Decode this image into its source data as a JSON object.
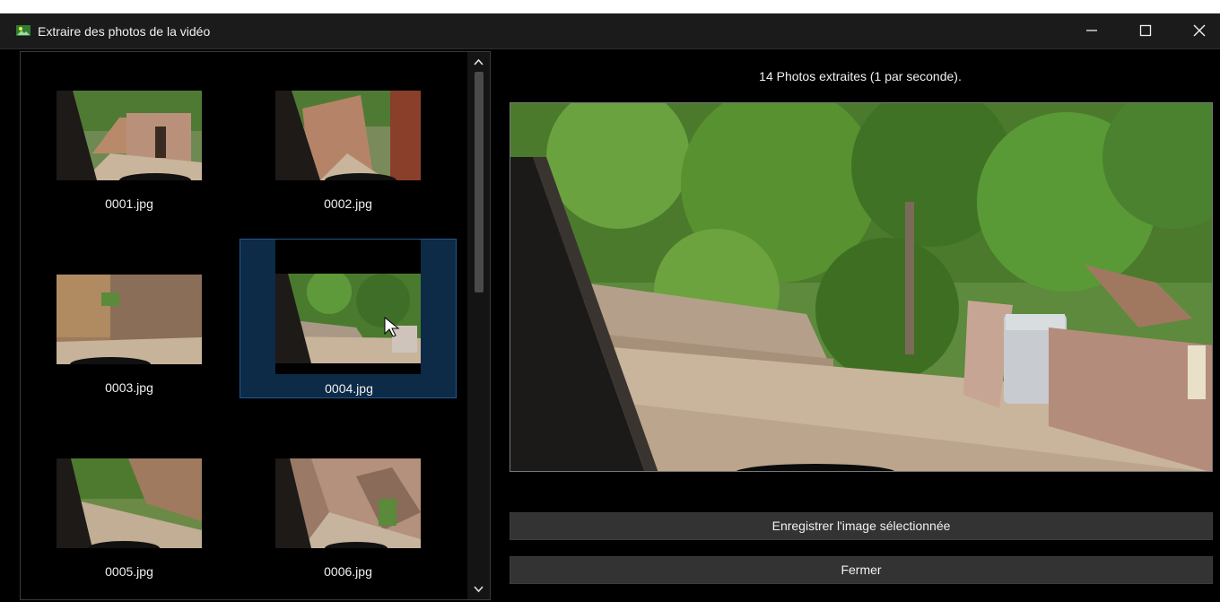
{
  "window": {
    "title": "Extraire des photos de la vidéo",
    "icon": "photo-extract-icon",
    "controls": [
      "minimize-icon",
      "maximize-icon",
      "close-icon"
    ]
  },
  "thumbnails": [
    {
      "filename": "0001.jpg",
      "selected": false
    },
    {
      "filename": "0002.jpg",
      "selected": false
    },
    {
      "filename": "0003.jpg",
      "selected": false
    },
    {
      "filename": "0004.jpg",
      "selected": true
    },
    {
      "filename": "0005.jpg",
      "selected": false
    },
    {
      "filename": "0006.jpg",
      "selected": false
    }
  ],
  "status": "14 Photos extraites (1 par seconde).",
  "buttons": {
    "save": "Enregistrer l'image sélectionnée",
    "close": "Fermer"
  },
  "colors": {
    "background": "#000000",
    "titlebar": "#1b1b1b",
    "selection": "#0d2a47",
    "selection_border": "#1e5a8f",
    "button": "#333333"
  }
}
